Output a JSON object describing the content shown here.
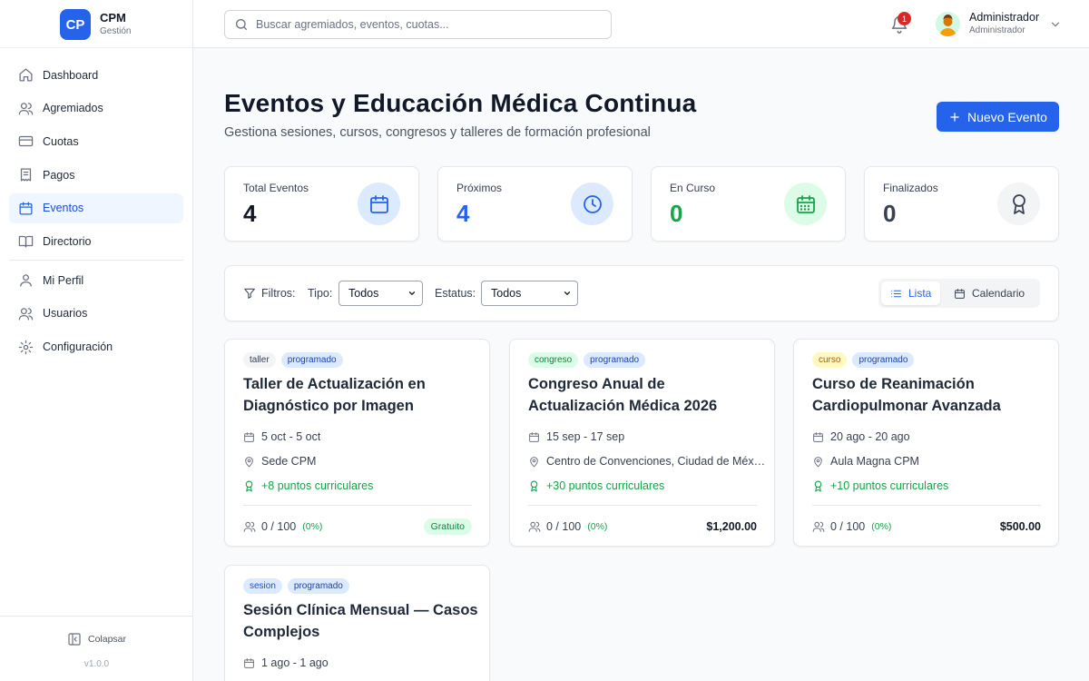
{
  "brand": {
    "logo": "CP",
    "name": "CPM",
    "subtitle": "Gestión",
    "accent": "#2563eb"
  },
  "sidebar": {
    "items": [
      {
        "label": "Dashboard",
        "icon": "home-icon"
      },
      {
        "label": "Agremiados",
        "icon": "users-icon"
      },
      {
        "label": "Cuotas",
        "icon": "credit-card-icon"
      },
      {
        "label": "Pagos",
        "icon": "receipt-icon"
      },
      {
        "label": "Eventos",
        "icon": "calendar-icon",
        "active": true
      },
      {
        "label": "Directorio",
        "icon": "book-icon"
      },
      {
        "label": "Mi Perfil",
        "icon": "user-icon"
      },
      {
        "label": "Usuarios",
        "icon": "users-icon"
      },
      {
        "label": "Configuración",
        "icon": "gear-icon"
      }
    ],
    "collapse_label": "Colapsar",
    "version": "v1.0.0"
  },
  "topbar": {
    "search_placeholder": "Buscar agremiados, eventos, cuotas...",
    "notification_count": "1",
    "user_name": "Administrador",
    "user_role": "Administrador"
  },
  "page": {
    "title": "Eventos y Educación Médica Continua",
    "subtitle": "Gestiona sesiones, cursos, congresos y talleres de formación profesional",
    "new_button": "Nuevo Evento"
  },
  "stats": [
    {
      "label": "Total Eventos",
      "value": "4",
      "value_color": "#111827",
      "icon": "calendar-icon",
      "icon_color": "#2563eb",
      "icon_bg": "#dbeafe"
    },
    {
      "label": "Próximos",
      "value": "4",
      "value_color": "#2563eb",
      "icon": "clock-icon",
      "icon_color": "#2563eb",
      "icon_bg": "#dbeafe"
    },
    {
      "label": "En Curso",
      "value": "0",
      "value_color": "#16a34a",
      "icon": "calendar-days-icon",
      "icon_color": "#16a34a",
      "icon_bg": "#dcfce7"
    },
    {
      "label": "Finalizados",
      "value": "0",
      "value_color": "#374151",
      "icon": "award-icon",
      "icon_color": "#374151",
      "icon_bg": "#f3f4f6"
    }
  ],
  "filters": {
    "label": "Filtros:",
    "type_label": "Tipo:",
    "type_value": "Todos",
    "status_label": "Estatus:",
    "status_value": "Todos",
    "view_list": "Lista",
    "view_calendar": "Calendario"
  },
  "events": [
    {
      "type": "taller",
      "type_color": "#374151",
      "type_bg": "#f3f4f6",
      "status": "programado",
      "title": "Taller de Actualización en Diagnóstico por Imagen",
      "dates": "5 oct - 5 oct",
      "location": "Sede CPM",
      "points": "+8 puntos curriculares",
      "capacity": "0 / 100",
      "percent": "(0%)",
      "price": "Gratuito",
      "free": true
    },
    {
      "type": "congreso",
      "type_color": "#15803d",
      "type_bg": "#dcfce7",
      "status": "programado",
      "title": "Congreso Anual de Actualización Médica 2026",
      "dates": "15 sep - 17 sep",
      "location": "Centro de Convenciones, Ciudad de México",
      "points": "+30 puntos curriculares",
      "capacity": "0 / 100",
      "percent": "(0%)",
      "price": "$1,200.00",
      "free": false
    },
    {
      "type": "curso",
      "type_color": "#a16207",
      "type_bg": "#fef9c3",
      "status": "programado",
      "title": "Curso de Reanimación Cardiopulmonar Avanzada",
      "dates": "20 ago - 20 ago",
      "location": "Aula Magna CPM",
      "points": "+10 puntos curriculares",
      "capacity": "0 / 100",
      "percent": "(0%)",
      "price": "$500.00",
      "free": false
    },
    {
      "type": "sesion",
      "type_color": "#1d4ed8",
      "type_bg": "#dbeafe",
      "status": "programado",
      "title": "Sesión Clínica Mensual — Casos Complejos",
      "dates": "1 ago - 1 ago"
    }
  ],
  "colors": {
    "status_tag_bg": "#dbeafe",
    "status_tag_text": "#1e40af"
  }
}
